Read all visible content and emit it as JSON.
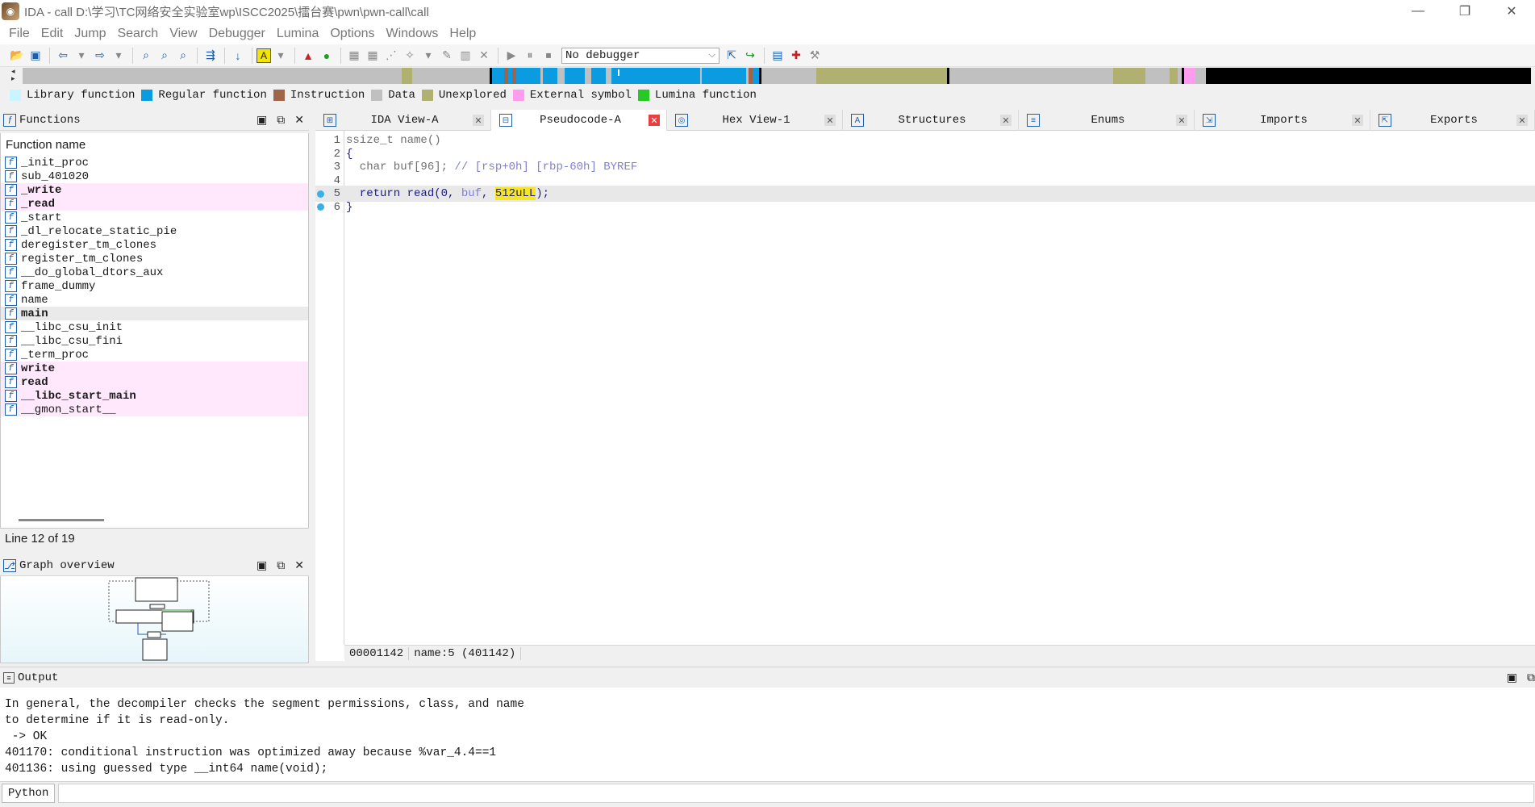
{
  "window": {
    "title": "IDA - call D:\\学习\\TC网络安全实验室wp\\ISCC2025\\擂台赛\\pwn\\pwn-call\\call",
    "minimize": "—",
    "restore": "❐",
    "close": "✕"
  },
  "menu": [
    "File",
    "Edit",
    "Jump",
    "Search",
    "View",
    "Debugger",
    "Lumina",
    "Options",
    "Windows",
    "Help"
  ],
  "toolbar": {
    "debugger_select": "No debugger"
  },
  "legend": [
    {
      "label": "Library function",
      "color": "#c8f5ff"
    },
    {
      "label": "Regular function",
      "color": "#0a9be0"
    },
    {
      "label": "Instruction",
      "color": "#a0644a"
    },
    {
      "label": "Data",
      "color": "#c0c0c0"
    },
    {
      "label": "Unexplored",
      "color": "#b0b070"
    },
    {
      "label": "External symbol",
      "color": "#ff9cf0"
    },
    {
      "label": "Lumina function",
      "color": "#28c828"
    }
  ],
  "functions": {
    "title": "Functions",
    "column": "Function name",
    "items": [
      {
        "name": "_init_proc",
        "ext": false,
        "bold": false,
        "sel": false
      },
      {
        "name": "sub_401020",
        "ext": false,
        "bold": false,
        "sel": false
      },
      {
        "name": "_write",
        "ext": true,
        "bold": true,
        "sel": false
      },
      {
        "name": "_read",
        "ext": true,
        "bold": true,
        "sel": false
      },
      {
        "name": "_start",
        "ext": false,
        "bold": false,
        "sel": false
      },
      {
        "name": "_dl_relocate_static_pie",
        "ext": false,
        "bold": false,
        "sel": false
      },
      {
        "name": "deregister_tm_clones",
        "ext": false,
        "bold": false,
        "sel": false
      },
      {
        "name": "register_tm_clones",
        "ext": false,
        "bold": false,
        "sel": false
      },
      {
        "name": "__do_global_dtors_aux",
        "ext": false,
        "bold": false,
        "sel": false
      },
      {
        "name": "frame_dummy",
        "ext": false,
        "bold": false,
        "sel": false
      },
      {
        "name": "name",
        "ext": false,
        "bold": false,
        "sel": false
      },
      {
        "name": "main",
        "ext": false,
        "bold": true,
        "sel": true
      },
      {
        "name": "__libc_csu_init",
        "ext": false,
        "bold": false,
        "sel": false
      },
      {
        "name": "__libc_csu_fini",
        "ext": false,
        "bold": false,
        "sel": false
      },
      {
        "name": "_term_proc",
        "ext": false,
        "bold": false,
        "sel": false
      },
      {
        "name": "write",
        "ext": true,
        "bold": true,
        "sel": false
      },
      {
        "name": "read",
        "ext": true,
        "bold": true,
        "sel": false
      },
      {
        "name": "__libc_start_main",
        "ext": true,
        "bold": true,
        "sel": false
      },
      {
        "name": "__gmon_start__",
        "ext": true,
        "bold": false,
        "sel": false
      }
    ],
    "status": "Line 12 of 19"
  },
  "graph": {
    "title": "Graph overview"
  },
  "tabs": [
    {
      "label": "IDA View-A",
      "icon": "idaview-icon",
      "active": false
    },
    {
      "label": "Pseudocode-A",
      "icon": "pseudocode-icon",
      "active": true
    },
    {
      "label": "Hex View-1",
      "icon": "hexview-icon",
      "active": false
    },
    {
      "label": "Structures",
      "icon": "structures-icon",
      "active": false
    },
    {
      "label": "Enums",
      "icon": "enums-icon",
      "active": false
    },
    {
      "label": "Imports",
      "icon": "imports-icon",
      "active": false
    },
    {
      "label": "Exports",
      "icon": "exports-icon",
      "active": false
    }
  ],
  "pseudocode": {
    "lines": [
      {
        "num": "1",
        "dot": false,
        "current": false,
        "segments": [
          {
            "t": "ssize_t name()",
            "c": "c-gray"
          }
        ]
      },
      {
        "num": "2",
        "dot": false,
        "current": false,
        "segments": [
          {
            "t": "{",
            "c": "c-blue"
          }
        ]
      },
      {
        "num": "3",
        "dot": false,
        "current": false,
        "segments": [
          {
            "t": "  char buf[96]; ",
            "c": "c-gray"
          },
          {
            "t": "// [rsp+0h] [rbp-60h] BYREF",
            "c": "c-cmt"
          }
        ]
      },
      {
        "num": "4",
        "dot": false,
        "current": false,
        "segments": [
          {
            "t": "",
            "c": "c-gray"
          }
        ]
      },
      {
        "num": "5",
        "dot": true,
        "current": true,
        "segments": [
          {
            "t": "  return read(0, ",
            "c": "c-blue"
          },
          {
            "t": "buf",
            "c": "c-cmt"
          },
          {
            "t": ", ",
            "c": "c-blue"
          },
          {
            "t": "512uLL",
            "c": "c-hl"
          },
          {
            "t": ");",
            "c": "c-blue"
          }
        ]
      },
      {
        "num": "6",
        "dot": true,
        "current": false,
        "segments": [
          {
            "t": "}",
            "c": "c-blue"
          }
        ]
      }
    ],
    "status": [
      "00001142",
      "name:5 (401142)"
    ]
  },
  "output": {
    "title": "Output",
    "lines": [
      "In general, the decompiler checks the segment permissions, class, and name",
      "to determine if it is read-only.",
      " -> OK",
      "401170: conditional instruction was optimized away because %var_4.4==1",
      "401136: using guessed type __int64 name(void);"
    ],
    "python_button": "Python"
  }
}
